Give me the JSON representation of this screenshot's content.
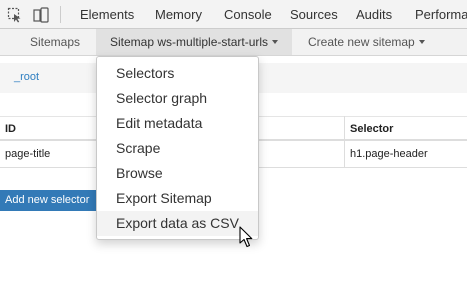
{
  "devtools": {
    "tabs": [
      "Elements",
      "Memory",
      "Console",
      "Sources",
      "Audits",
      "Performa"
    ],
    "icons": [
      "inspect-element-icon",
      "device-toolbar-icon"
    ]
  },
  "nav": {
    "sitemaps": "Sitemaps",
    "current_sitemap": "Sitemap ws-multiple-start-urls",
    "create": "Create new sitemap"
  },
  "breadcrumb": {
    "root": "_root"
  },
  "table": {
    "headers": {
      "id": "ID",
      "selector": "Selector"
    },
    "rows": [
      {
        "id": "page-title",
        "selector": "h1.page-header"
      }
    ]
  },
  "add_selector_label": "Add new selector",
  "dropdown": {
    "items": [
      "Selectors",
      "Selector graph",
      "Edit metadata",
      "Scrape",
      "Browse",
      "Export Sitemap",
      "Export data as CSV"
    ],
    "hovered_index": 6
  },
  "colors": {
    "accent": "#337ab7",
    "link": "#2f7fc1"
  }
}
